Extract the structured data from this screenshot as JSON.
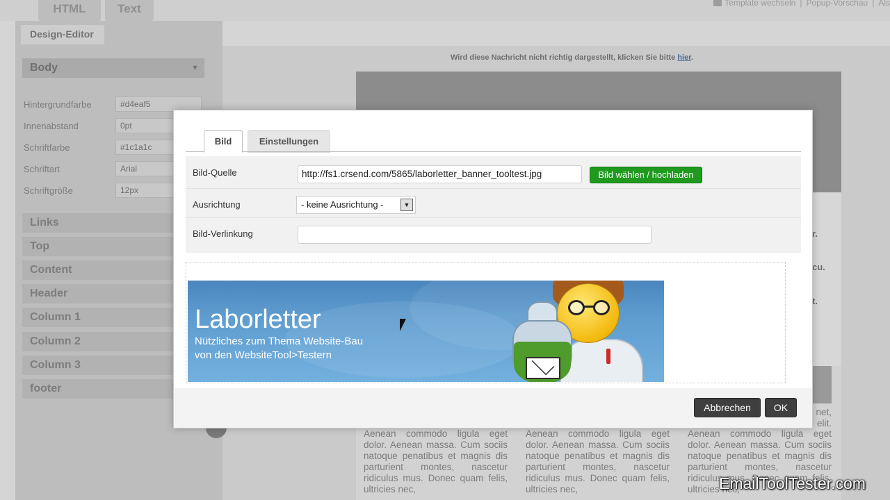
{
  "editor_tabs": {
    "html": "HTML",
    "text": "Text"
  },
  "top_links": {
    "template_switch": "Template wechseln",
    "popup_preview": "Popup-Vorschau",
    "cut": "Als"
  },
  "design_editor": {
    "title": "Design-Editor",
    "body_section": {
      "title": "Body",
      "properties": [
        {
          "label": "Hintergrundfarbe",
          "value": "#d4eaf5"
        },
        {
          "label": "Innenabstand",
          "value": "0pt"
        },
        {
          "label": "Schriftfarbe",
          "value": "#1c1a1c"
        },
        {
          "label": "Schriftart",
          "value": "Arial"
        },
        {
          "label": "Schriftgröße",
          "value": "12px"
        }
      ]
    },
    "sections": [
      "Links",
      "Top",
      "Content",
      "Header",
      "Column 1",
      "Column 2",
      "Column 3",
      "footer"
    ]
  },
  "email_preview": {
    "notice": "Wird diese Nachricht nicht richtig dargestellt, klicken Sie bitte",
    "notice_link": "hier",
    "notice_end": ".",
    "side_fragments": [
      "r.",
      "cu.",
      "t."
    ],
    "right_fragments": [
      "net,",
      "elit."
    ],
    "column_text": "Aenean commodo ligula eget dolor. Aenean massa. Cum sociis natoque penatibus et magnis dis parturient montes, nascetur ridiculus mus. Donec quam felis, ultricies nec,"
  },
  "dialog": {
    "tabs": {
      "image": "Bild",
      "settings": "Einstellungen"
    },
    "fields": {
      "source_label": "Bild-Quelle",
      "source_value": "http://fs1.crsend.com/5865/laborletter_banner_tooltest.jpg",
      "upload_button": "Bild wählen / hochladen",
      "align_label": "Ausrichtung",
      "align_value": "- keine Ausrichtung -",
      "link_label": "Bild-Verlinkung",
      "link_value": ""
    },
    "banner": {
      "title": "Laborletter",
      "subtitle_line1": "Nützliches zum Thema Website-Bau",
      "subtitle_line2": "von den WebsiteTool>Testern"
    },
    "buttons": {
      "cancel": "Abbrechen",
      "ok": "OK"
    }
  },
  "watermark": "EmailToolTester.com",
  "colors": {
    "upload_green": "#1f9a1f",
    "dark_button": "#3f3f3f",
    "banner_blue": "#5e9ccf"
  }
}
